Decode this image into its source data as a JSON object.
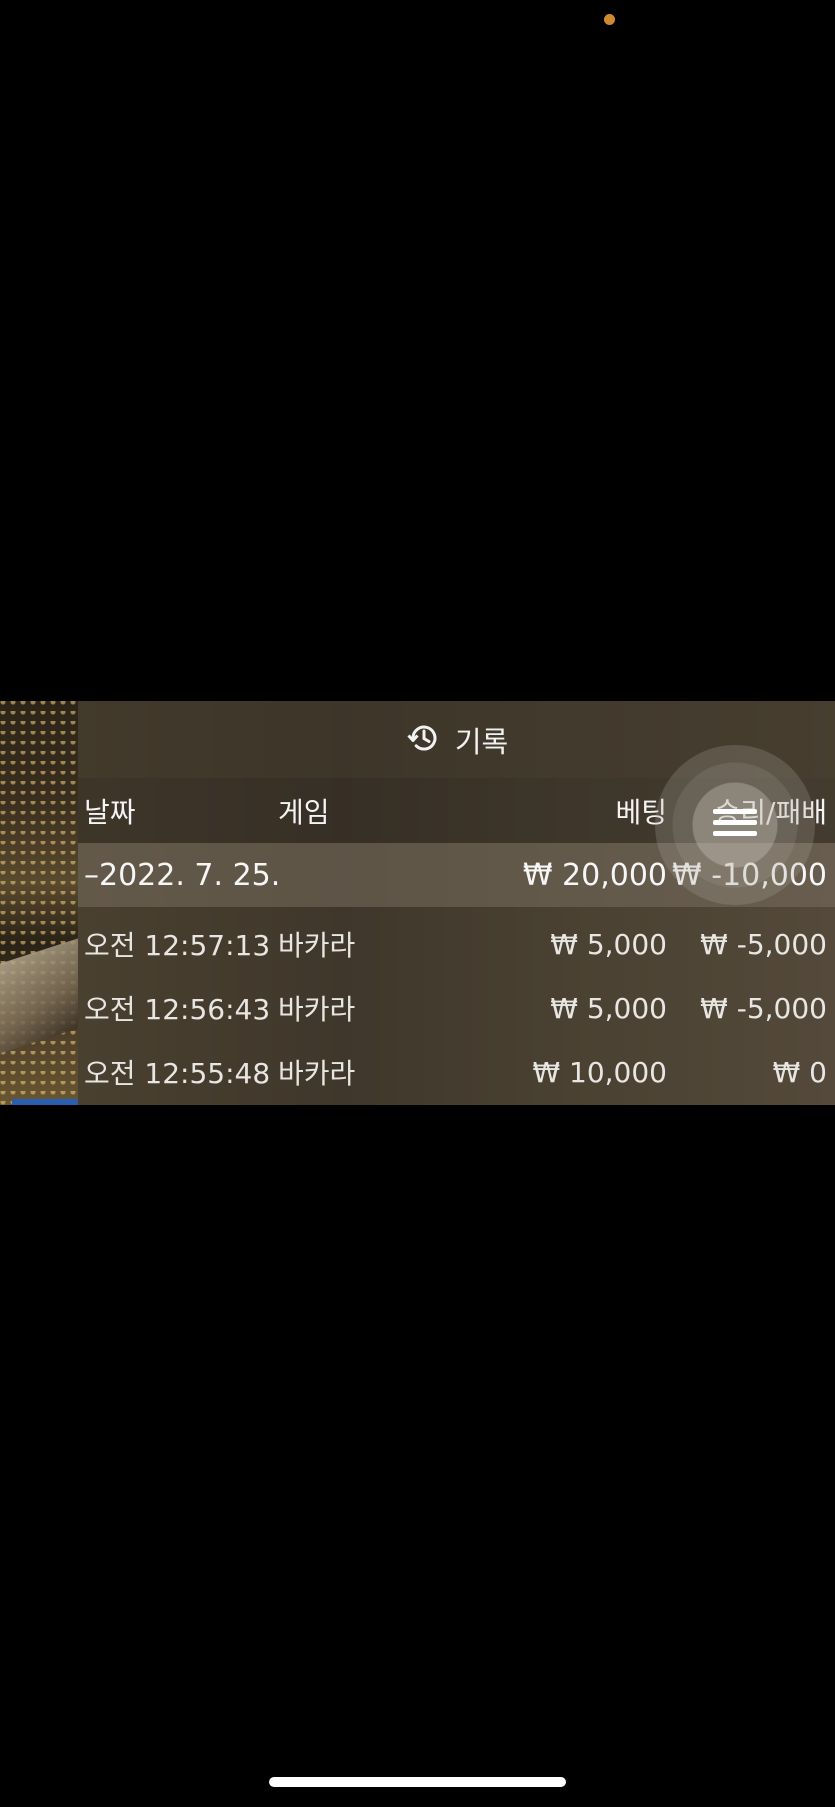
{
  "history": {
    "title": "기록",
    "icon": "history-icon",
    "columns": {
      "date": "날짜",
      "game": "게임",
      "bet": "베팅",
      "win_loss": "승리/패배"
    },
    "summary": {
      "date": "–2022. 7. 25.",
      "bet": "₩ 20,000",
      "win_loss": "₩ -10,000"
    },
    "rows": [
      {
        "time": "오전 12:57:13",
        "game": "바카라",
        "bet": "₩ 5,000",
        "win_loss": "₩ -5,000"
      },
      {
        "time": "오전 12:56:43",
        "game": "바카라",
        "bet": "₩ 5,000",
        "win_loss": "₩ -5,000"
      },
      {
        "time": "오전 12:55:48",
        "game": "바카라",
        "bet": "₩ 10,000",
        "win_loss": "₩ 0"
      }
    ]
  },
  "menu_button": {
    "icon": "menu-icon"
  },
  "colors": {
    "status_dot": "#d08a2e",
    "background": "#000000"
  }
}
